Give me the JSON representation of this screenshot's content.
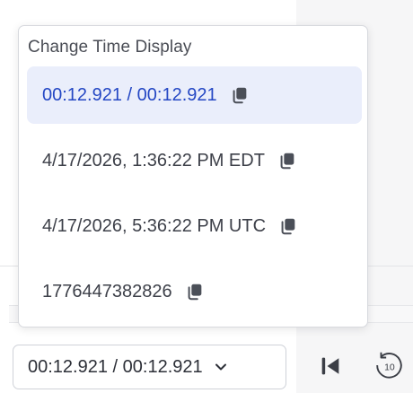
{
  "dropdown": {
    "title": "Change Time Display",
    "options": [
      {
        "label": "00:12.921 / 00:12.921",
        "selected": true,
        "copy_icon": "copy-icon"
      },
      {
        "label": "4/17/2026, 1:36:22 PM EDT",
        "selected": false,
        "copy_icon": "copy-icon"
      },
      {
        "label": "4/17/2026, 5:36:22 PM UTC",
        "selected": false,
        "copy_icon": "copy-icon"
      },
      {
        "label": "1776447382826",
        "selected": false,
        "copy_icon": "copy-icon"
      }
    ]
  },
  "controls": {
    "time_select_value": "00:12.921 / 00:12.921",
    "time_select_icon": "chevron-down-icon",
    "skip_back_icon": "skip-to-start-icon",
    "rewind_icon": "rewind-10-icon",
    "rewind_label": "10"
  },
  "colors": {
    "accent": "#2447c4",
    "selected_bg": "#eaeefb",
    "text": "#3d4049"
  }
}
